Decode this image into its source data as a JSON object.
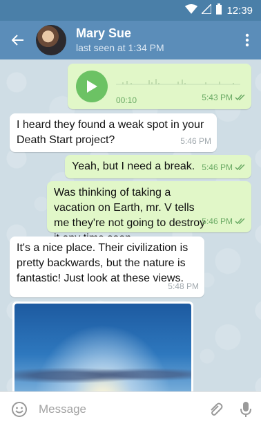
{
  "status_bar": {
    "time": "12:39"
  },
  "header": {
    "name": "Mary Sue",
    "last_seen": "last seen at 1:34 PM"
  },
  "messages": [
    {
      "type": "voice",
      "direction": "out",
      "duration": "00:10",
      "time": "5:43 PM",
      "read": true
    },
    {
      "type": "text",
      "direction": "in",
      "text": "I heard they found a weak spot in your Death Start project?",
      "time": "5:46 PM"
    },
    {
      "type": "text",
      "direction": "out",
      "text": "Yeah, but I need a break.",
      "time": "5:46 PM",
      "read": true
    },
    {
      "type": "text",
      "direction": "out",
      "text": "Was thinking of taking a vacation on Earth, mr. V tells me they're not going to destroy it any time soon.",
      "time": "5:46 PM",
      "read": true
    },
    {
      "type": "text",
      "direction": "in",
      "text": "It's a nice place. Their civilization is pretty backwards, but the nature is fantastic! Just look at these views.",
      "time": "5:48 PM"
    },
    {
      "type": "photo",
      "direction": "in"
    }
  ],
  "composer": {
    "placeholder": "Message"
  },
  "colors": {
    "header": "#5b8db9",
    "status_bar": "#4a7fa8",
    "outgoing_bubble": "#e1f7c8",
    "incoming_bubble": "#ffffff",
    "play_button": "#6cc264",
    "read_check": "#6aaa64"
  },
  "icons": {
    "back": "arrow-left-icon",
    "menu": "more-vertical-icon",
    "play": "play-icon",
    "emoji": "smiley-icon",
    "attach": "paperclip-icon",
    "mic": "microphone-icon",
    "wifi": "wifi-icon",
    "signal": "signal-icon",
    "battery": "battery-icon"
  }
}
